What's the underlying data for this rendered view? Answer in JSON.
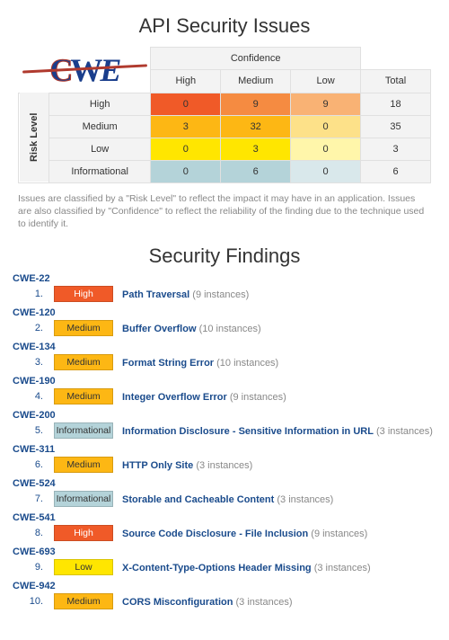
{
  "title": "API Security Issues",
  "logo": {
    "text1": "C",
    "text2": "W",
    "text3": "E",
    "alt": "cwe-logo"
  },
  "matrix": {
    "conf_header": "Confidence",
    "conf_cols": [
      "High",
      "Medium",
      "Low"
    ],
    "total_col": "Total",
    "risk_header": "Risk Level",
    "rows": [
      {
        "label": "High",
        "cells": [
          {
            "v": 0,
            "cls": "c-r3"
          },
          {
            "v": 9,
            "cls": "c-r2"
          },
          {
            "v": 9,
            "cls": "c-r1"
          }
        ],
        "total": 18
      },
      {
        "label": "Medium",
        "cells": [
          {
            "v": 3,
            "cls": "c-o2"
          },
          {
            "v": 32,
            "cls": "c-o2"
          },
          {
            "v": 0,
            "cls": "c-o1"
          }
        ],
        "total": 35
      },
      {
        "label": "Low",
        "cells": [
          {
            "v": 0,
            "cls": "c-y2"
          },
          {
            "v": 3,
            "cls": "c-y2"
          },
          {
            "v": 0,
            "cls": "c-y1"
          }
        ],
        "total": 3
      },
      {
        "label": "Informational",
        "cells": [
          {
            "v": 0,
            "cls": "c-b2"
          },
          {
            "v": 6,
            "cls": "c-b2"
          },
          {
            "v": 0,
            "cls": "c-b1"
          }
        ],
        "total": 6
      }
    ]
  },
  "caption": "Issues are classified by a \"Risk Level\" to reflect the impact it may have in an application. Issues are also classified by \"Confidence\" to reflect the reliability of the finding due to the technique used to identify it.",
  "findings_title": "Security Findings",
  "findings": [
    {
      "idx": 1,
      "cwe": "CWE-22",
      "risk": "High",
      "title": "Path Traversal",
      "instances": 9
    },
    {
      "idx": 2,
      "cwe": "CWE-120",
      "risk": "Medium",
      "title": "Buffer Overflow",
      "instances": 10
    },
    {
      "idx": 3,
      "cwe": "CWE-134",
      "risk": "Medium",
      "title": "Format String Error",
      "instances": 10
    },
    {
      "idx": 4,
      "cwe": "CWE-190",
      "risk": "Medium",
      "title": "Integer Overflow Error",
      "instances": 9
    },
    {
      "idx": 5,
      "cwe": "CWE-200",
      "risk": "Informational",
      "title": "Information Disclosure - Sensitive Information in URL",
      "instances": 3
    },
    {
      "idx": 6,
      "cwe": "CWE-311",
      "risk": "Medium",
      "title": "HTTP Only Site",
      "instances": 3
    },
    {
      "idx": 7,
      "cwe": "CWE-524",
      "risk": "Informational",
      "title": "Storable and Cacheable Content",
      "instances": 3
    },
    {
      "idx": 8,
      "cwe": "CWE-541",
      "risk": "High",
      "title": "Source Code Disclosure - File Inclusion",
      "instances": 9
    },
    {
      "idx": 9,
      "cwe": "CWE-693",
      "risk": "Low",
      "title": "X-Content-Type-Options Header Missing",
      "instances": 3
    },
    {
      "idx": 10,
      "cwe": "CWE-942",
      "risk": "Medium",
      "title": "CORS Misconfiguration",
      "instances": 3
    }
  ]
}
